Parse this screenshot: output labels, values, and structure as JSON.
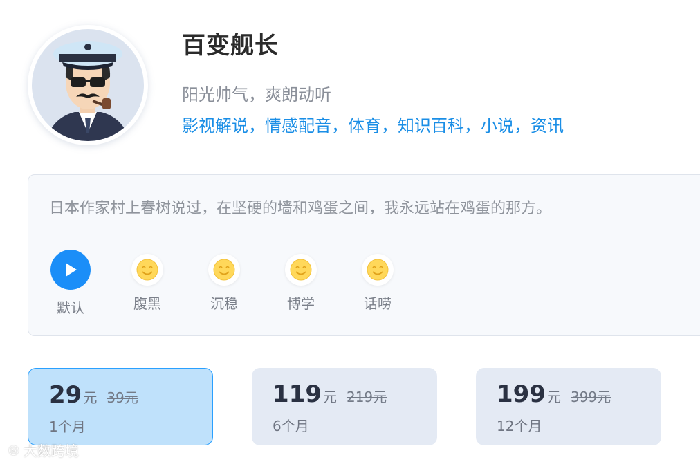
{
  "profile": {
    "name": "百变舰长",
    "description": "阳光帅气，爽朗动听",
    "tags": "影视解说，情感配音，体育，知识百科，小说，资讯"
  },
  "sample": {
    "quote": "日本作家村上春树说过，在坚硬的墙和鸡蛋之间，我永远站在鸡蛋的那方。"
  },
  "styles": [
    {
      "label": "默认",
      "icon": "play-icon"
    },
    {
      "label": "腹黑",
      "icon": "smile-icon"
    },
    {
      "label": "沉稳",
      "icon": "smile-icon"
    },
    {
      "label": "博学",
      "icon": "smile-icon"
    },
    {
      "label": "话唠",
      "icon": "smile-icon"
    }
  ],
  "plans": [
    {
      "price": "29",
      "unit": "元",
      "original": "39元",
      "duration": "1个月",
      "selected": true
    },
    {
      "price": "119",
      "unit": "元",
      "original": "219元",
      "duration": "6个月",
      "selected": false
    },
    {
      "price": "199",
      "unit": "元",
      "original": "399元",
      "duration": "12个月",
      "selected": false
    }
  ],
  "watermark": {
    "text": "大数跨境"
  },
  "colors": {
    "accent": "#1b8ef8",
    "tag_blue": "#1a8ee6",
    "selected_bg": "#bfe1fb",
    "plan_bg": "#e4eaf4"
  }
}
